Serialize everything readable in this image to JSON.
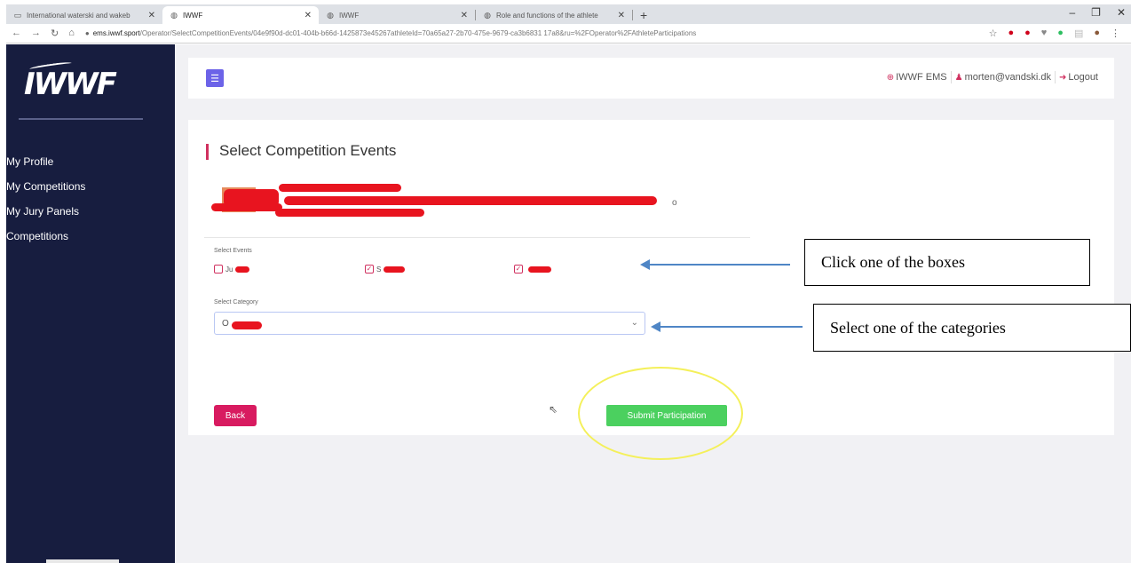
{
  "browser": {
    "tabs": [
      {
        "title": "International waterski and wakeb",
        "icon": "iwwf-favicon",
        "active": false
      },
      {
        "title": "IWWF",
        "icon": "globe-icon",
        "active": true
      },
      {
        "title": "IWWF",
        "icon": "globe-icon",
        "active": false
      },
      {
        "title": "Role and functions of the athlete",
        "icon": "globe-icon",
        "active": false
      }
    ],
    "new_tab": "+",
    "url_host": "ems.iwwf.sport",
    "url_path": "/Operator/SelectCompetitionEvents/04e9f90d-dc01-404b-b66d-1425873e45267athleteId=70a65a27-2b70-475e-9679-ca3b6831 17a8&ru=%2FOperator%2FAthleteParticipations"
  },
  "sidebar": {
    "logo": "IWWF",
    "items": [
      {
        "label": "My Profile"
      },
      {
        "label": "My Competitions"
      },
      {
        "label": "My Jury Panels"
      },
      {
        "label": "Competitions"
      }
    ]
  },
  "topbar": {
    "ems_label": "IWWF EMS",
    "user_email": "morten@vandski.dk",
    "logout_label": "Logout"
  },
  "main": {
    "title": "Select Competition Events",
    "athlete_line_end": "o",
    "events_label": "Select Events",
    "events": [
      {
        "label": "Ju",
        "checked": false
      },
      {
        "label": "S",
        "checked": true
      },
      {
        "label": "",
        "checked": true
      }
    ],
    "category_label": "Select Category",
    "category_value": "O",
    "back_label": "Back",
    "submit_label": "Submit Participation"
  },
  "annotations": {
    "boxes_note": "Click one of the boxes",
    "category_note": "Select one of the categories"
  },
  "colors": {
    "sidebar_bg": "#171d3f",
    "accent_pink": "#d81b60",
    "submit_green": "#4bd05f",
    "toggle_purple": "#6c63e8",
    "highlight_yellow": "#f4f05a",
    "arrow_blue": "#4f86c6",
    "redaction_red": "#e8141f"
  }
}
